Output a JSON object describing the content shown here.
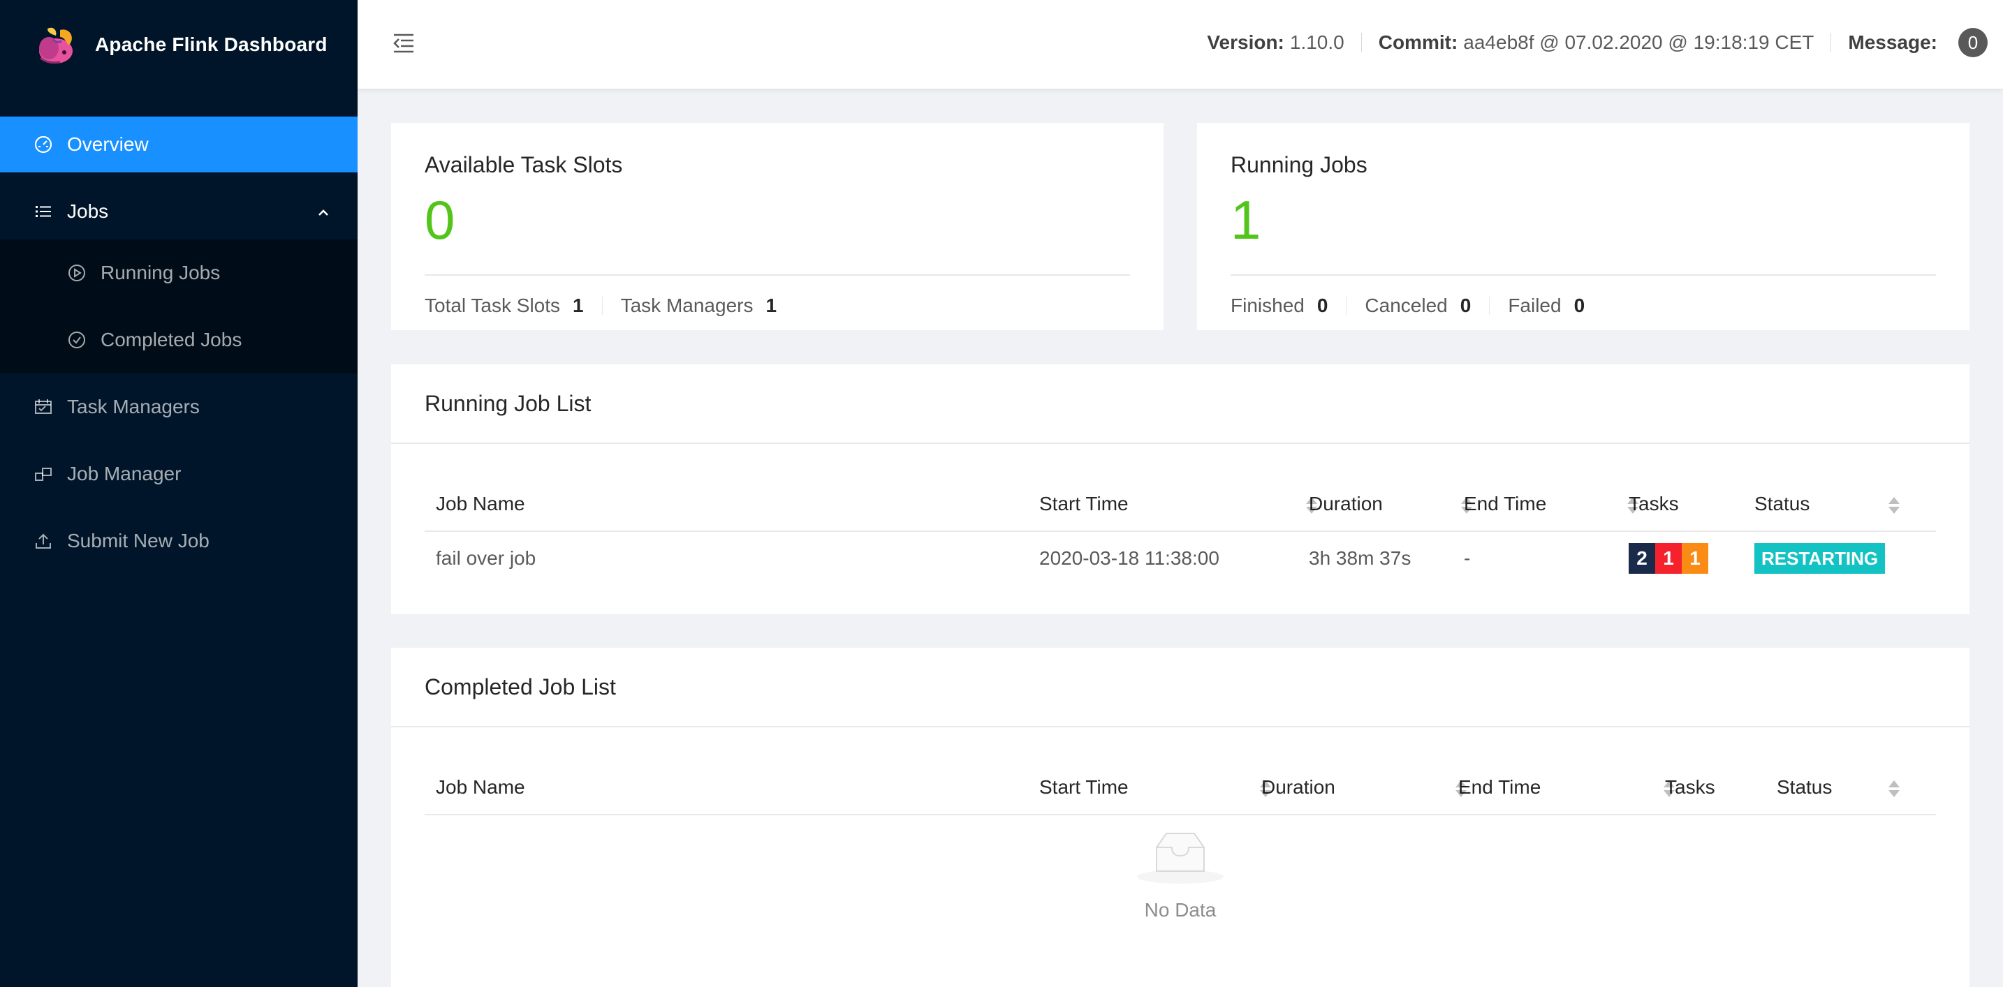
{
  "app": {
    "title": "Apache Flink Dashboard",
    "logo_icon": "flink-squirrel-logo"
  },
  "sidebar": {
    "items": [
      {
        "label": "Overview",
        "icon": "dashboard-icon",
        "active": true
      },
      {
        "label": "Jobs",
        "icon": "list-icon",
        "expanded": true,
        "children": [
          {
            "label": "Running Jobs",
            "icon": "play-circle-icon"
          },
          {
            "label": "Completed Jobs",
            "icon": "check-circle-icon"
          }
        ]
      },
      {
        "label": "Task Managers",
        "icon": "schedule-icon"
      },
      {
        "label": "Job Manager",
        "icon": "build-icon"
      },
      {
        "label": "Submit New Job",
        "icon": "upload-icon"
      }
    ]
  },
  "header": {
    "version_label": "Version:",
    "version_value": "1.10.0",
    "commit_label": "Commit:",
    "commit_value": "aa4eb8f @ 07.02.2020 @ 19:18:19 CET",
    "message_label": "Message:",
    "message_count": "0"
  },
  "slots_card": {
    "title": "Available Task Slots",
    "value": "0",
    "footer": [
      {
        "label": "Total Task Slots",
        "value": "1"
      },
      {
        "label": "Task Managers",
        "value": "1"
      }
    ]
  },
  "jobs_card": {
    "title": "Running Jobs",
    "value": "1",
    "footer": [
      {
        "label": "Finished",
        "value": "0"
      },
      {
        "label": "Canceled",
        "value": "0"
      },
      {
        "label": "Failed",
        "value": "0"
      }
    ]
  },
  "running_list": {
    "title": "Running Job List",
    "columns": [
      "Job Name",
      "Start Time",
      "Duration",
      "End Time",
      "Tasks",
      "Status"
    ],
    "rows": [
      {
        "name": "fail over job",
        "start": "2020-03-18 11:38:00",
        "duration": "3h 38m 37s",
        "end": "-",
        "tasks": [
          {
            "count": "2",
            "color": "#1a2a4a"
          },
          {
            "count": "1",
            "color": "#f5222d"
          },
          {
            "count": "1",
            "color": "#fa8c16"
          }
        ],
        "status": "RESTARTING",
        "status_color": "#13c2c2"
      }
    ]
  },
  "completed_list": {
    "title": "Completed Job List",
    "columns": [
      "Job Name",
      "Start Time",
      "Duration",
      "End Time",
      "Tasks",
      "Status"
    ],
    "empty_text": "No Data"
  },
  "colors": {
    "sidebar_bg": "#001529",
    "active_item": "#1890ff",
    "stat_green": "#52c41a"
  }
}
